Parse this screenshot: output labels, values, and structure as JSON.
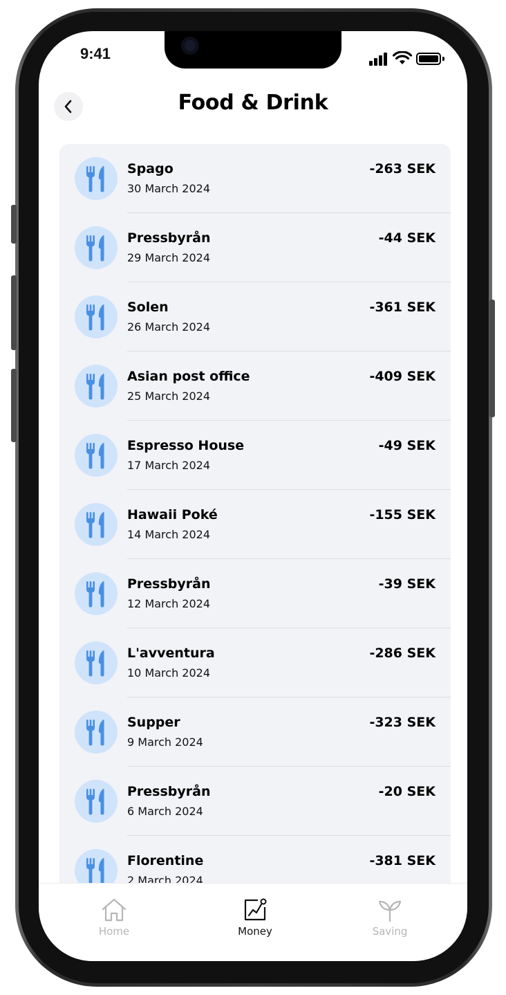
{
  "status_bar": {
    "time": "9:41"
  },
  "header": {
    "title": "Food & Drink"
  },
  "transactions": [
    {
      "name": "Spago",
      "date": "30 March 2024",
      "amount": "-263 SEK"
    },
    {
      "name": "Pressbyrån",
      "date": "29 March 2024",
      "amount": "-44 SEK"
    },
    {
      "name": "Solen",
      "date": "26 March 2024",
      "amount": "-361 SEK"
    },
    {
      "name": "Asian post office",
      "date": "25 March 2024",
      "amount": "-409 SEK"
    },
    {
      "name": "Espresso House",
      "date": "17 March 2024",
      "amount": "-49 SEK"
    },
    {
      "name": "Hawaii Poké",
      "date": "14 March 2024",
      "amount": "-155 SEK"
    },
    {
      "name": "Pressbyrån",
      "date": "12 March 2024",
      "amount": "-39 SEK"
    },
    {
      "name": "L'avventura",
      "date": "10 March 2024",
      "amount": "-286 SEK"
    },
    {
      "name": "Supper",
      "date": "9 March 2024",
      "amount": "-323 SEK"
    },
    {
      "name": "Pressbyrån",
      "date": "6 March 2024",
      "amount": "-20 SEK"
    },
    {
      "name": "Florentine",
      "date": "2 March 2024",
      "amount": "-381 SEK"
    }
  ],
  "tab_bar": {
    "tabs": [
      {
        "label": "Home",
        "icon": "home-icon",
        "active": false
      },
      {
        "label": "Money",
        "icon": "chart-icon",
        "active": true
      },
      {
        "label": "Saving",
        "icon": "sprout-icon",
        "active": false
      }
    ]
  },
  "colors": {
    "accent": "#4a90e2",
    "icon_background": "#cfe3fb",
    "card_background": "#f2f3f7",
    "inactive_tab": "#b5b5b5"
  }
}
